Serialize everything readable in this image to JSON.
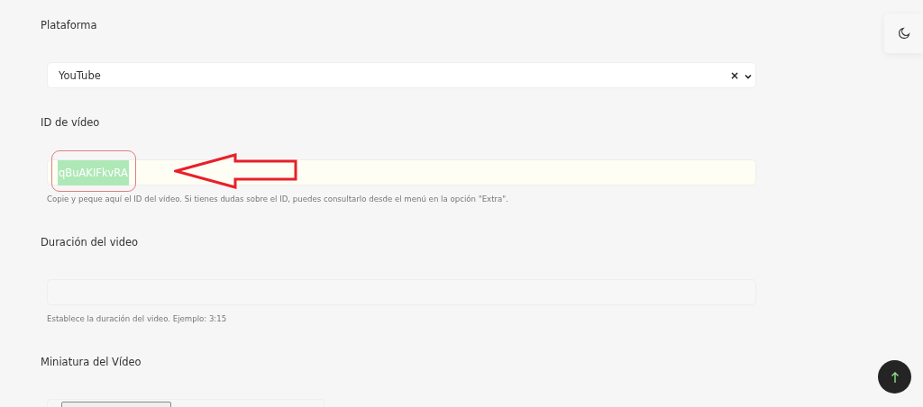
{
  "fields": [
    {
      "kind": "select",
      "label": "Plataforma",
      "value": "YouTube",
      "clear": "×"
    },
    {
      "kind": "text",
      "label": "ID de vídeo",
      "value": "qBuAKIFkvRA",
      "highlighted": true,
      "annotated": true,
      "help": "Copie y peque aquí el ID del vídeo. Si tienes dudas sobre el ID, puedes consultarlo desde el menú en la opción \"Extra\"."
    },
    {
      "kind": "text",
      "label": "Duración del video",
      "help": "Establece la duración del video. Ejemplo: 3:15"
    },
    {
      "kind": "file",
      "label": "Miniatura del Vídeo"
    }
  ]
}
